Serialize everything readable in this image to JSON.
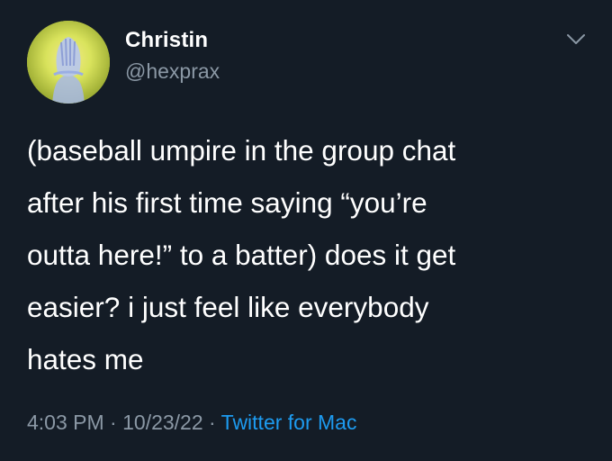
{
  "tweet": {
    "display_name": "Christin",
    "handle": "@hexprax",
    "text": "(baseball umpire in the group chat\nafter his first time saying “you’re\noutta here!” to a batter) does it get\neasier? i just feel like everybody\nhates me",
    "time": "4:03 PM",
    "separator": " · ",
    "date": "10/23/22",
    "separator2": " · ",
    "source": "Twitter for Mac",
    "more_icon": "chevron-down-icon",
    "avatar_icon": "avatar-hands-over-face"
  },
  "colors": {
    "background": "#141c26",
    "text": "#ffffff",
    "secondary": "#8b98a5",
    "link": "#1d9bf0"
  }
}
